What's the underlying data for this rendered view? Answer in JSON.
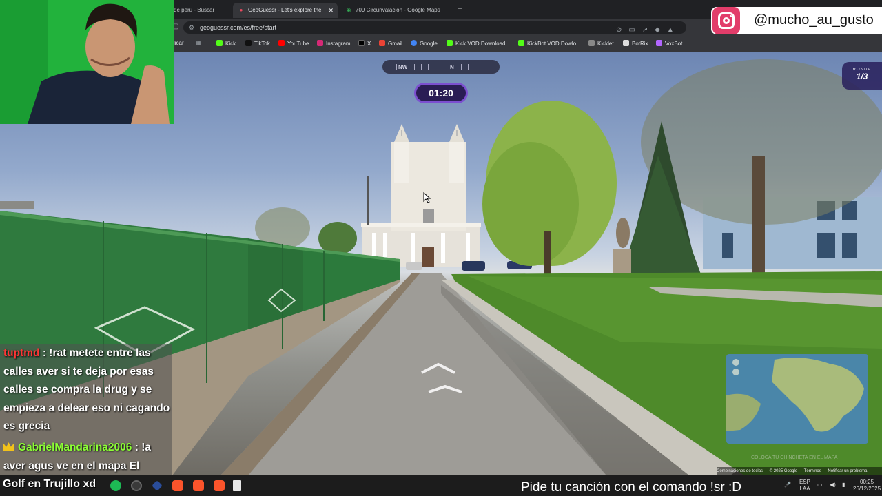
{
  "browser": {
    "tabs": [
      {
        "label": "de perú - Buscar",
        "active": false
      },
      {
        "label": "GeoGuessr - Let's explore the",
        "active": true
      },
      {
        "label": "709 Circunvalación - Google Maps",
        "active": false
      }
    ],
    "new_tab_icon": "+",
    "close_icon": "✕",
    "url": "geoguessr.com/es/free/start",
    "bookmarks": [
      {
        "label": "licar",
        "color": "#f3a21a"
      },
      {
        "label": "Kick",
        "color": "#53fc18"
      },
      {
        "label": "TikTok",
        "color": "#111111"
      },
      {
        "label": "YouTube",
        "color": "#ff0000"
      },
      {
        "label": "Instagram",
        "color": "#d62976"
      },
      {
        "label": "X",
        "color": "#000000"
      },
      {
        "label": "Gmail",
        "color": "#ea4335"
      },
      {
        "label": "Google",
        "color": "#4285f4"
      },
      {
        "label": "Kick VOD Download...",
        "color": "#53fc18"
      },
      {
        "label": "KickBot VOD Dowlo...",
        "color": "#53fc18"
      },
      {
        "label": "Kicklet",
        "color": "#888888"
      },
      {
        "label": "BotRix",
        "color": "#dddddd"
      },
      {
        "label": "VoxBot",
        "color": "#b266ff"
      }
    ]
  },
  "instagram": {
    "handle": "@mucho_au_gusto"
  },
  "game": {
    "compass": {
      "labels": [
        "NW",
        "N"
      ]
    },
    "timer": "01:20",
    "round_label": "RONDA",
    "round_value": "1/3",
    "map_caption": "COLOCA TU CHINCHETA EN EL MAPA",
    "map_attribution": [
      "Combinaciones de teclas",
      "© 2025 Google",
      "Términos",
      "Notificar un problema"
    ]
  },
  "chat": {
    "messages": [
      {
        "user": "tuptmd",
        "text": ": !rat metete entre las calles aver si te deja por esas calles se compra la drug y se empieza a delear eso ni cagando es grecia"
      },
      {
        "user": "GabrielMandarina2006",
        "text": ": !a aver agus ve en el mapa El"
      }
    ]
  },
  "stream": {
    "title": "Golf en Trujillo xd",
    "ticker": "Pide tu canción con el comando !sr :D"
  },
  "taskbar": {
    "language": "ESP",
    "layout": "LAA",
    "time": "00:25",
    "date": "26/12/2025"
  }
}
